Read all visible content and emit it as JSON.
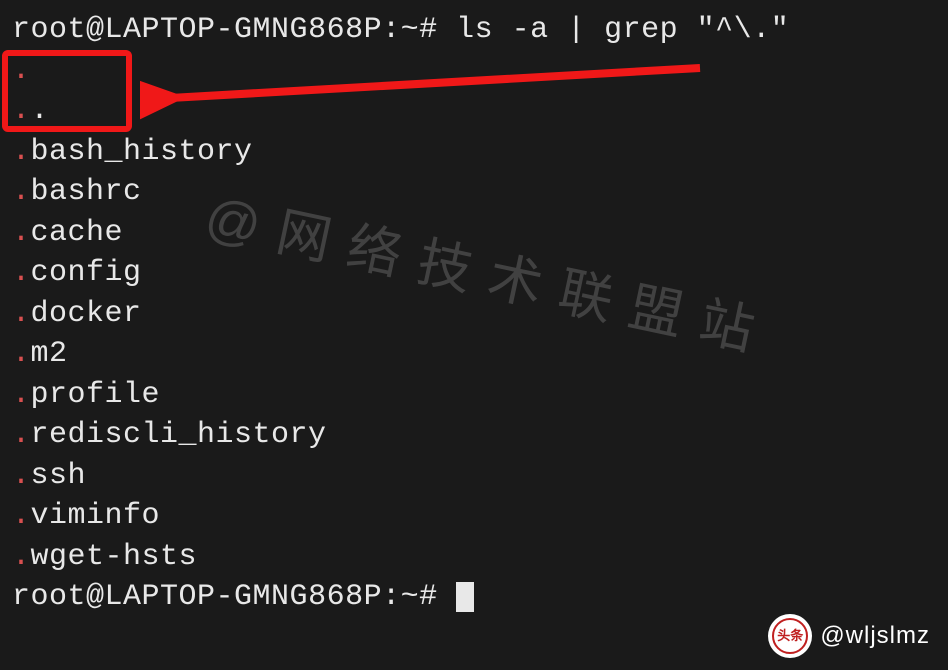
{
  "prompt": {
    "user": "root",
    "host": "LAPTOP-GMNG868P",
    "path": "~",
    "symbol": "#"
  },
  "command": "ls -a | grep \"^\\.\"",
  "output": [
    {
      "dot": ".",
      "rest": ""
    },
    {
      "dot": ".",
      "rest": "."
    },
    {
      "dot": ".",
      "rest": "bash_history"
    },
    {
      "dot": ".",
      "rest": "bashrc"
    },
    {
      "dot": ".",
      "rest": "cache"
    },
    {
      "dot": ".",
      "rest": "config"
    },
    {
      "dot": ".",
      "rest": "docker"
    },
    {
      "dot": ".",
      "rest": "m2"
    },
    {
      "dot": ".",
      "rest": "profile"
    },
    {
      "dot": ".",
      "rest": "rediscli_history"
    },
    {
      "dot": ".",
      "rest": "ssh"
    },
    {
      "dot": ".",
      "rest": "viminfo"
    },
    {
      "dot": ".",
      "rest": "wget-hsts"
    }
  ],
  "watermark": "@网络技术联盟站",
  "footer": {
    "badge": "头条",
    "handle": "@wljslmz"
  },
  "colors": {
    "bg": "#1a1a1a",
    "fg": "#e8e8e8",
    "match": "#d85050",
    "highlight_border": "#f01818",
    "arrow": "#f01818"
  }
}
